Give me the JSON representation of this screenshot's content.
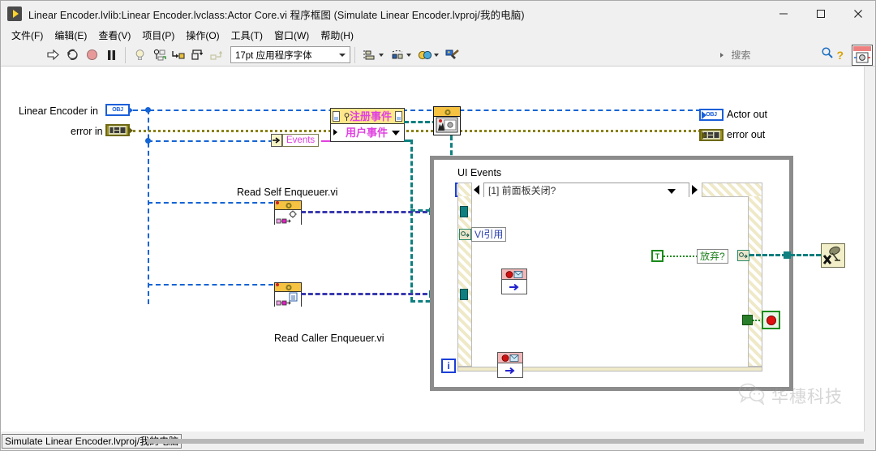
{
  "window": {
    "title": "Linear Encoder.lvlib:Linear Encoder.lvclass:Actor Core.vi 程序框图  (Simulate Linear Encoder.lvproj/我的电脑)",
    "app_icon": "labview-run-arrow-icon",
    "minimize_label": "—",
    "maximize_label": "□",
    "close_label": "✕"
  },
  "menubar": {
    "items": [
      {
        "label": "文件(F)"
      },
      {
        "label": "编辑(E)"
      },
      {
        "label": "查看(V)"
      },
      {
        "label": "项目(P)"
      },
      {
        "label": "操作(O)"
      },
      {
        "label": "工具(T)"
      },
      {
        "label": "窗口(W)"
      },
      {
        "label": "帮助(H)"
      }
    ]
  },
  "toolbar": {
    "run_icon": "run-arrow-icon",
    "run_continuous_icon": "run-continuously-icon",
    "abort_icon": "abort-execution-icon",
    "pause_icon": "pause-icon",
    "highlight_icon": "highlight-execution-lightbulb-icon",
    "retain_values_icon": "retain-wire-values-icon",
    "step_into_icon": "step-into-icon",
    "step_over_icon": "step-over-icon",
    "step_out_icon": "step-out-icon",
    "font_selector_value": "17pt 应用程序字体",
    "align_objects_icon": "align-objects-icon",
    "distribute_objects_icon": "distribute-objects-icon",
    "reorder_icon": "reorder-icon",
    "clean_up_diagram_icon": "clean-up-diagram-icon",
    "search_placeholder": "搜索",
    "search_value": "",
    "search_icon": "magnifier-icon",
    "help_icon": "context-help-question-icon"
  },
  "statusbar": {
    "text": "Simulate Linear Encoder.lvproj/我的电脑"
  },
  "watermark": {
    "icon": "wechat-logo-icon",
    "text": "华穗科技"
  },
  "diagram": {
    "terminals": {
      "linear_encoder_in": {
        "label": "Linear Encoder in",
        "glyph": "OBJ",
        "type": "object-refnum"
      },
      "error_in": {
        "label": "error in",
        "glyph": "",
        "type": "error-cluster"
      },
      "actor_out": {
        "label": "Actor out",
        "glyph": "OBJ",
        "type": "object-refnum"
      },
      "error_out": {
        "label": "error out",
        "glyph": "",
        "type": "error-cluster"
      }
    },
    "nodes": {
      "events_constant": {
        "label": "Events",
        "name": "events-cluster-constant"
      },
      "register_events": {
        "title": "注册事件",
        "item": "用户事件",
        "name": "register-for-events-node"
      },
      "call_parent_method": {
        "name": "call-parent-method-node",
        "icon": "actor-core-parent-icon"
      },
      "read_self_enqueuer": {
        "label": "Read Self Enqueuer.vi",
        "name": "read-self-enqueuer-subvi"
      },
      "read_caller_enqueuer": {
        "label": "Read Caller Enqueuer.vi",
        "name": "read-caller-enqueuer-subvi"
      },
      "unregister_events": {
        "name": "unregister-for-events-node",
        "icon": "unregister-events-icon"
      }
    },
    "event_structure": {
      "title": "UI Events",
      "timeout_icon": "hourglass-timeout-icon",
      "case_selector": "[1] 前面板关闭?",
      "left_arrow": "◀",
      "right_arrow": "▶",
      "iteration_terminal": "i",
      "stop_terminal_icon": "stop-loop-condition-icon",
      "inner": {
        "vi_refnum_label": "VI引用",
        "discard_label": "放弃?",
        "boolean_constant": "T",
        "enqueue_node_top": "enqueue-message-node",
        "enqueue_node_bottom": "enqueue-message-node"
      }
    }
  },
  "colors": {
    "object_wire": "#1464d4",
    "error_wire": "#8a8000",
    "event_wire": "#0f7f7f",
    "boolean_wire": "#1e8a1e",
    "subvi_header": "#f5c242",
    "structure_border": "#8c8c8c"
  }
}
